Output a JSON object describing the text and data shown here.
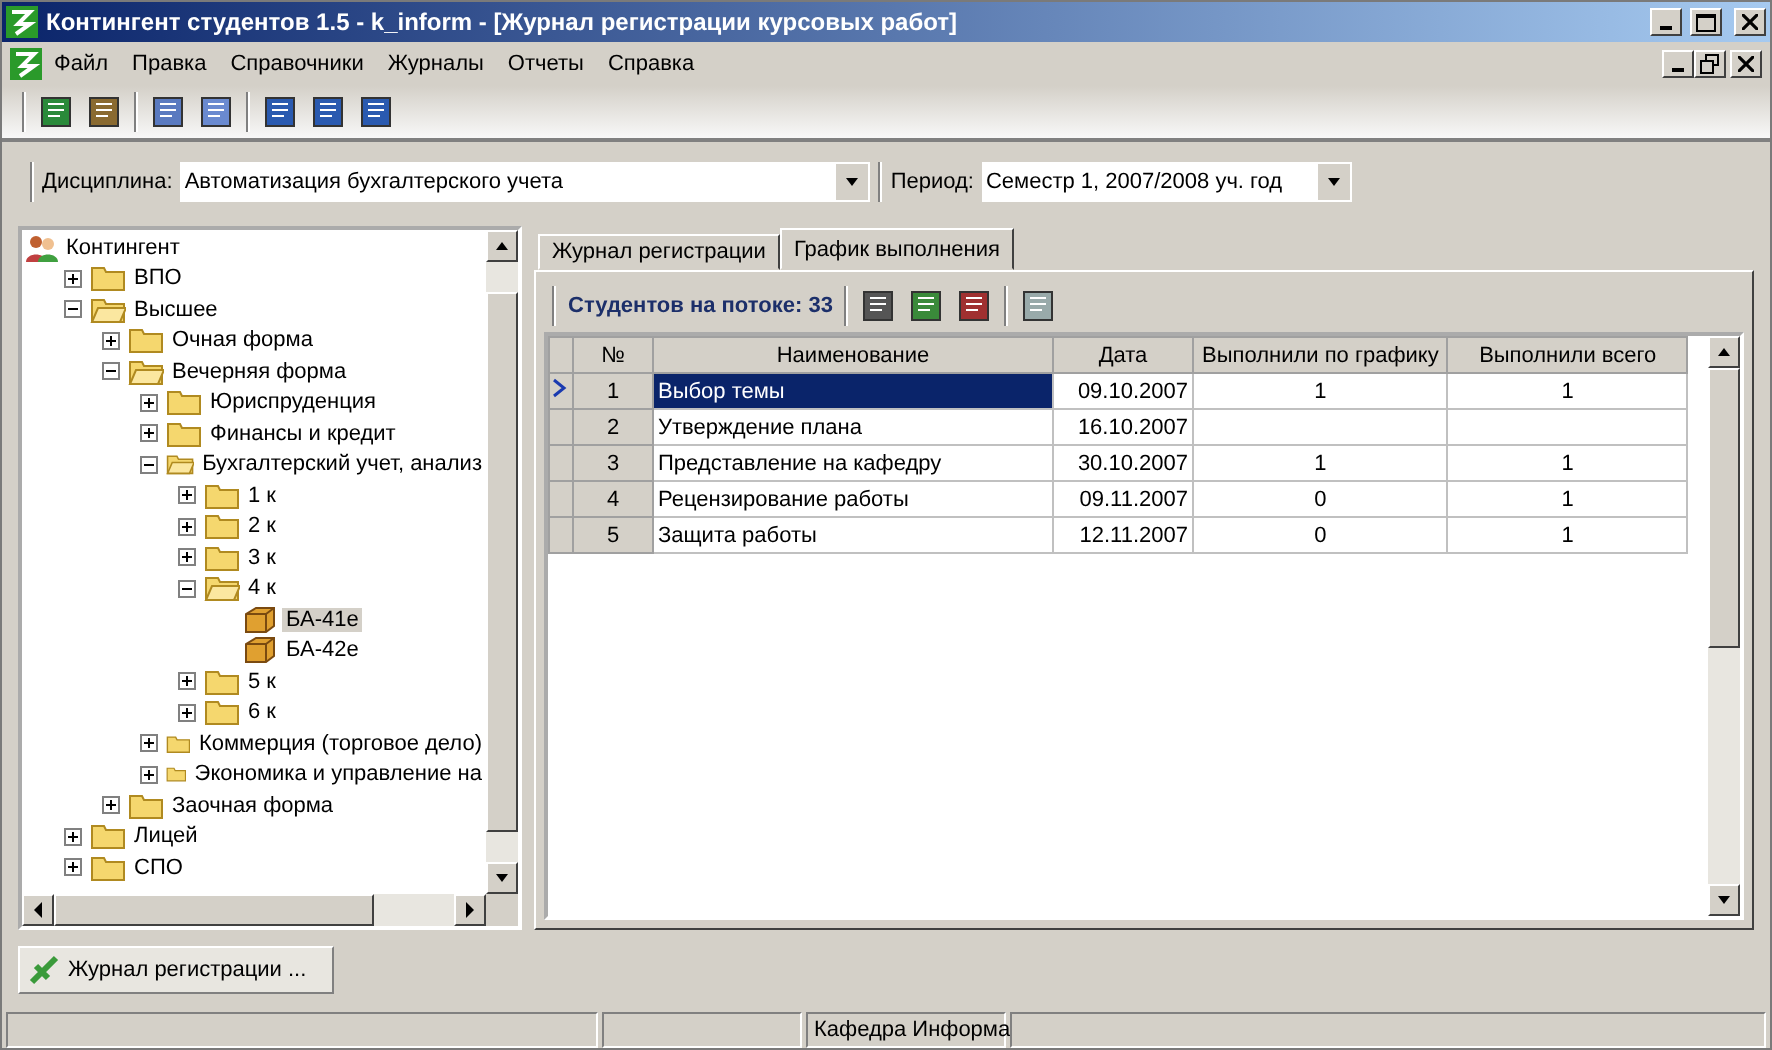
{
  "window": {
    "title": "Контингент студентов 1.5 - k_inform - [Журнал регистрации курсовых работ]"
  },
  "menu": [
    "Файл",
    "Правка",
    "Справочники",
    "Журналы",
    "Отчеты",
    "Справка"
  ],
  "filters": [
    {
      "label": "Дисциплина:",
      "value": "Автоматизация бухгалтерского учета"
    },
    {
      "label": "Период:",
      "value": "Семестр 1, 2007/2008 уч. год"
    }
  ],
  "tree": [
    {
      "label": "Контингент",
      "kind": "root",
      "selected": false,
      "children": [
        {
          "label": "ВПО",
          "kind": "folder",
          "expanded": false,
          "selected": false
        },
        {
          "label": "Высшее",
          "kind": "folder",
          "expanded": true,
          "selected": false,
          "children": [
            {
              "label": "Очная форма",
              "kind": "folder",
              "expanded": false,
              "selected": false
            },
            {
              "label": "Вечерняя форма",
              "kind": "folder",
              "expanded": true,
              "selected": false,
              "children": [
                {
                  "label": "Юриспруденция",
                  "kind": "folder",
                  "expanded": false,
                  "selected": false
                },
                {
                  "label": "Финансы и кредит",
                  "kind": "folder",
                  "expanded": false,
                  "selected": false
                },
                {
                  "label": "Бухгалтерский учет, анализ",
                  "kind": "folder",
                  "expanded": true,
                  "selected": false,
                  "children": [
                    {
                      "label": "1 к",
                      "kind": "folder",
                      "expanded": false,
                      "selected": false
                    },
                    {
                      "label": "2 к",
                      "kind": "folder",
                      "expanded": false,
                      "selected": false
                    },
                    {
                      "label": "3 к",
                      "kind": "folder",
                      "expanded": false,
                      "selected": false
                    },
                    {
                      "label": "4 к",
                      "kind": "folder",
                      "expanded": true,
                      "selected": false,
                      "children": [
                        {
                          "label": "БА-41е",
                          "kind": "group",
                          "selected": true
                        },
                        {
                          "label": "БА-42е",
                          "kind": "group",
                          "selected": false
                        }
                      ]
                    },
                    {
                      "label": "5 к",
                      "kind": "folder",
                      "expanded": false,
                      "selected": false
                    },
                    {
                      "label": "6 к",
                      "kind": "folder",
                      "expanded": false,
                      "selected": false
                    }
                  ]
                },
                {
                  "label": "Коммерция (торговое дело)",
                  "kind": "folder",
                  "expanded": false,
                  "selected": false
                },
                {
                  "label": "Экономика и управление на",
                  "kind": "folder",
                  "expanded": false,
                  "selected": false
                }
              ]
            },
            {
              "label": "Заочная форма",
              "kind": "folder",
              "expanded": false,
              "selected": false
            }
          ]
        },
        {
          "label": "Лицей",
          "kind": "folder",
          "expanded": false,
          "selected": false
        },
        {
          "label": "СПО",
          "kind": "folder",
          "expanded": false,
          "selected": false
        }
      ]
    }
  ],
  "tabs": [
    {
      "label": "Журнал регистрации",
      "selected": false
    },
    {
      "label": "График выполнения",
      "selected": true
    }
  ],
  "students": {
    "label": "Студентов на потоке:",
    "count": "33"
  },
  "table": {
    "columns": [
      "№",
      "Наименование",
      "Дата",
      "Выполнили по графику",
      "Выполнили всего"
    ],
    "rows": [
      {
        "cells": [
          "1",
          "Выбор темы",
          "09.10.2007",
          "1",
          "1"
        ],
        "selected": true
      },
      {
        "cells": [
          "2",
          "Утверждение плана",
          "16.10.2007",
          "",
          ""
        ],
        "selected": false
      },
      {
        "cells": [
          "3",
          "Представление на кафедру",
          "30.10.2007",
          "1",
          "1"
        ],
        "selected": false
      },
      {
        "cells": [
          "4",
          "Рецензирование работы",
          "09.11.2007",
          "0",
          "1"
        ],
        "selected": false
      },
      {
        "cells": [
          "5",
          "Защита работы",
          "12.11.2007",
          "0",
          "1"
        ],
        "selected": false
      }
    ]
  },
  "taskbar": [
    {
      "label": "Журнал регистрации ...",
      "selected": true
    }
  ],
  "status_bar": {
    "department": "Кафедра Информа"
  }
}
